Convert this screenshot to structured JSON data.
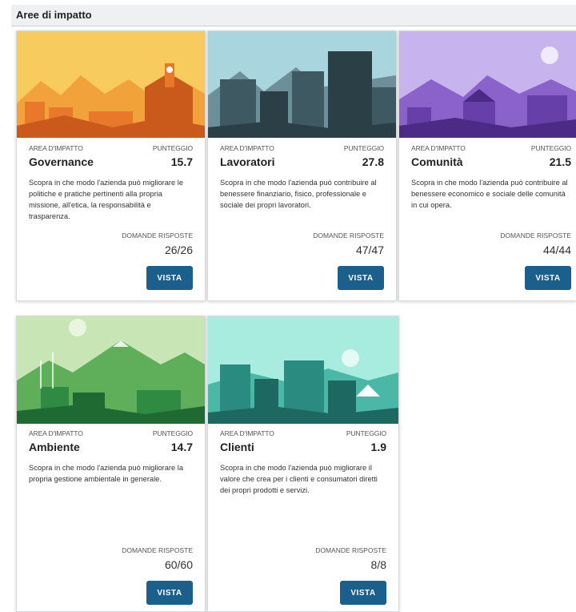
{
  "section": {
    "title": "Aree di impatto"
  },
  "cards": [
    {
      "area_label": "AREA D'IMPATTO",
      "score_label": "PUNTEGGIO",
      "title": "Governance",
      "score": "15.7",
      "description": "Scopra in che modo l'azienda può migliorare le politiche e pratiche pertinenti alla propria missione, all'etica, la responsabilità e trasparenza.",
      "questions_label": "DOMANDE RISPOSTE",
      "questions_value": "26/26",
      "button_label": "VISTA",
      "colors": {
        "sky": "#f8cb5f",
        "mid": "#f2a23a",
        "front": "#e9782a",
        "dark": "#c95a1c"
      }
    },
    {
      "area_label": "AREA D'IMPATTO",
      "score_label": "PUNTEGGIO",
      "title": "Lavoratori",
      "score": "27.8",
      "description": "Scopra in che modo l'azienda può contribuire al benessere finanziario, fisico, professionale e sociale dei propri lavoratori.",
      "questions_label": "DOMANDE RISPOSTE",
      "questions_value": "47/47",
      "button_label": "VISTA",
      "colors": {
        "sky": "#a9d5de",
        "mid": "#6d8f99",
        "front": "#3f5963",
        "dark": "#2b3f47"
      }
    },
    {
      "area_label": "AREA D'IMPATTO",
      "score_label": "PUNTEGGIO",
      "title": "Comunità",
      "score": "21.5",
      "description": "Scopra in che modo l'azienda può contribuire al benessere economico e sociale delle comunità in cui opera.",
      "questions_label": "DOMANDE RISPOSTE",
      "questions_value": "44/44",
      "button_label": "VISTA",
      "colors": {
        "sky": "#c7b4ef",
        "mid": "#8a62c9",
        "front": "#6640a8",
        "dark": "#4b2b86"
      }
    },
    {
      "area_label": "AREA D'IMPATTO",
      "score_label": "PUNTEGGIO",
      "title": "Ambiente",
      "score": "14.7",
      "description": "Scopra in che modo l'azienda può migliorare la propria gestione ambientale in generale.",
      "questions_label": "DOMANDE RISPOSTE",
      "questions_value": "60/60",
      "button_label": "VISTA",
      "colors": {
        "sky": "#c8e6b5",
        "mid": "#5fae5a",
        "front": "#2f8a42",
        "dark": "#1f6a33"
      }
    },
    {
      "area_label": "AREA D'IMPATTO",
      "score_label": "PUNTEGGIO",
      "title": "Clienti",
      "score": "1.9",
      "description": "Scopra in che modo l'azienda può migliorare il valore che crea per i clienti e consumatori diretti dei propri prodotti e servizi.",
      "questions_label": "DOMANDE RISPOSTE",
      "questions_value": "8/8",
      "button_label": "VISTA",
      "colors": {
        "sky": "#a8ece0",
        "mid": "#4bb7a6",
        "front": "#2a8c81",
        "dark": "#1e6862"
      }
    }
  ]
}
